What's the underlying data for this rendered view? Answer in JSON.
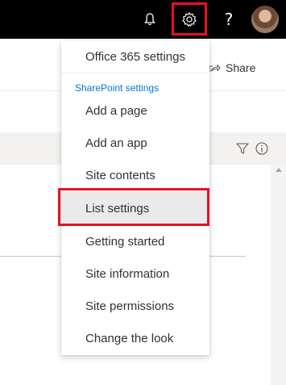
{
  "suite_bar": {
    "notifications_icon": "bell-icon",
    "settings_icon": "gear-icon",
    "help_label": "?",
    "highlight_color": "#e81123"
  },
  "page": {
    "share_label": "Share",
    "share_icon": "share-icon",
    "filter_icon": "filter-icon",
    "info_icon": "info-icon"
  },
  "settings_menu": {
    "top_item": "Office 365 settings",
    "section_label": "SharePoint settings",
    "items": [
      "Add a page",
      "Add an app",
      "Site contents",
      "List settings",
      "Getting started",
      "Site information",
      "Site permissions",
      "Change the look"
    ],
    "selected_item": "List settings",
    "section_color": "#0078d4"
  }
}
